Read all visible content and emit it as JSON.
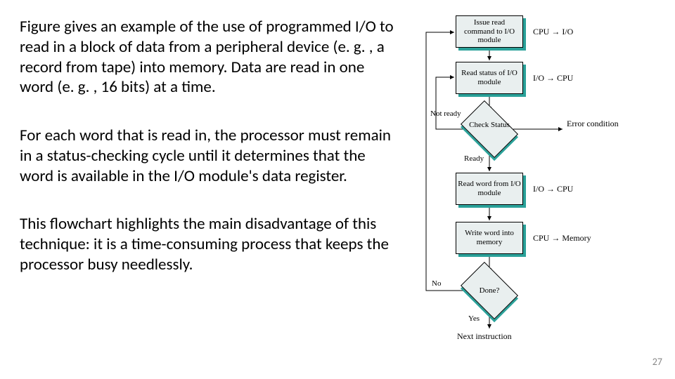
{
  "text": {
    "p1": "Figure gives an example of the use of programmed I/O to read in a block of data from a peripheral device (e. g. , a record from tape) into memory. Data are read in one word (e. g. , 16 bits) at a time.",
    "p2": "For each word that is read in, the processor must remain in a status-checking cycle until it determines that the word is available in the I/O module's data register.",
    "p3": "This flowchart highlights the main disadvantage of this technique: it is a time-consuming process that keeps the processor busy needlessly."
  },
  "flow": {
    "box1": "Issue read command to I/O module",
    "box2": "Read status of I/O module",
    "box3": "Read word from I/O module",
    "box4": "Write word into memory",
    "d1": "Check Status",
    "d2": "Done?",
    "side1": "CPU → I/O",
    "side2": "I/O → CPU",
    "side3": "I/O → CPU",
    "side4": "CPU → Memory",
    "not_ready": "Not ready",
    "ready": "Ready",
    "error": "Error condition",
    "no": "No",
    "yes": "Yes",
    "next": "Next instruction"
  },
  "page": "27",
  "chart_data": {
    "type": "flowchart",
    "nodes": [
      {
        "id": "n1",
        "shape": "process",
        "label": "Issue read command to I/O module",
        "side": "CPU → I/O"
      },
      {
        "id": "n2",
        "shape": "process",
        "label": "Read status of I/O module",
        "side": "I/O → CPU"
      },
      {
        "id": "n3",
        "shape": "decision",
        "label": "Check Status"
      },
      {
        "id": "n4",
        "shape": "process",
        "label": "Read word from I/O module",
        "side": "I/O → CPU"
      },
      {
        "id": "n5",
        "shape": "process",
        "label": "Write word into memory",
        "side": "CPU → Memory"
      },
      {
        "id": "n6",
        "shape": "decision",
        "label": "Done?"
      },
      {
        "id": "n7",
        "shape": "terminal",
        "label": "Next instruction"
      }
    ],
    "edges": [
      {
        "from": "n1",
        "to": "n2"
      },
      {
        "from": "n2",
        "to": "n3"
      },
      {
        "from": "n3",
        "to": "n2",
        "label": "Not ready"
      },
      {
        "from": "n3",
        "to": "error",
        "label": "Error condition"
      },
      {
        "from": "n3",
        "to": "n4",
        "label": "Ready"
      },
      {
        "from": "n4",
        "to": "n5"
      },
      {
        "from": "n5",
        "to": "n6"
      },
      {
        "from": "n6",
        "to": "n1",
        "label": "No"
      },
      {
        "from": "n6",
        "to": "n7",
        "label": "Yes"
      }
    ]
  }
}
